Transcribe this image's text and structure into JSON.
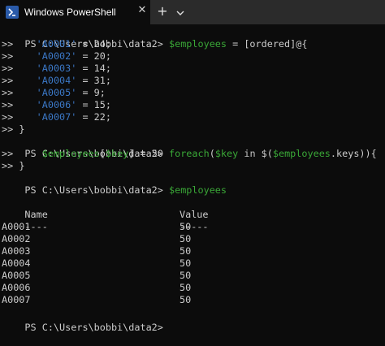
{
  "window": {
    "tab_title": "Windows PowerShell",
    "new_tab_label": "+",
    "close_label": "✕"
  },
  "console": {
    "prompt": "PS C:\\Users\\bobbi\\data2> ",
    "cont": ">>",
    "lines": {
      "l1": {
        "var": "$employees",
        "rest": " = [ordered]@{"
      },
      "entries": [
        {
          "key": "'A0001'",
          "val": "24"
        },
        {
          "key": "'A0002'",
          "val": "20"
        },
        {
          "key": "'A0003'",
          "val": "14"
        },
        {
          "key": "'A0004'",
          "val": "31"
        },
        {
          "key": "'A0005'",
          "val": "9"
        },
        {
          "key": "'A0006'",
          "val": "15"
        },
        {
          "key": "'A0007'",
          "val": "22"
        }
      ],
      "close_brace": "}",
      "l10": {
        "cmd": "foreach",
        "p1": "(",
        "var1": "$key",
        "in": " in ",
        "p2": "$(",
        "var2": "$employees",
        "p3": ".keys)){"
      },
      "l11": {
        "var1": "$employees",
        "p1": "[",
        "var2": "$key",
        "p2": "]",
        "eq": " = ",
        "val": "50"
      },
      "l13": {
        "var": "$employees"
      },
      "table": {
        "headers": [
          "Name",
          "Value"
        ],
        "underlines": [
          "----",
          "-----"
        ],
        "rows": [
          [
            "A0001",
            "50"
          ],
          [
            "A0002",
            "50"
          ],
          [
            "A0003",
            "50"
          ],
          [
            "A0004",
            "50"
          ],
          [
            "A0005",
            "50"
          ],
          [
            "A0006",
            "50"
          ],
          [
            "A0007",
            "50"
          ]
        ]
      }
    }
  }
}
